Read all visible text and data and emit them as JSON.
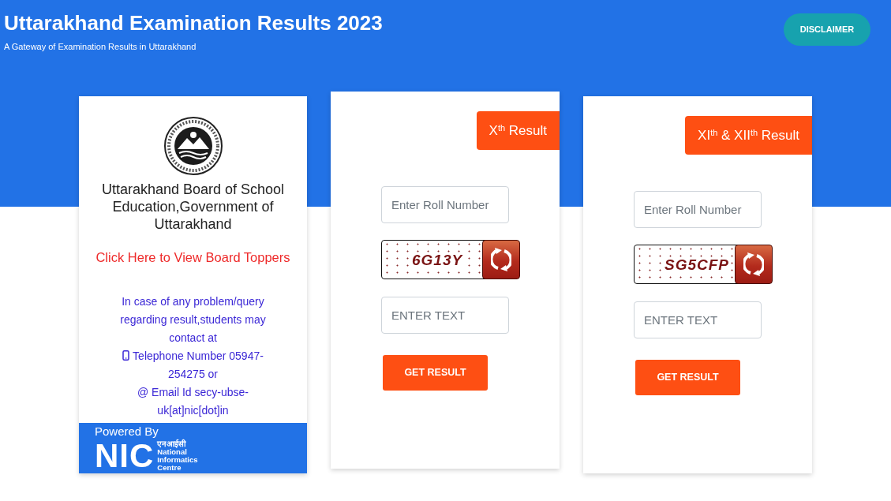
{
  "header": {
    "title": "Uttarakhand Examination Results 2023",
    "subtitle": "A Gateway of Examination Results in Uttarakhand",
    "disclaimer_button": "DISCLAIMER"
  },
  "board_card": {
    "name": "Uttarakhand Board of School Education,Government of Uttarakhand",
    "toppers_link": "Click Here to View Board Toppers",
    "contact_intro": "In case of any problem/query regarding result,students may contact at",
    "telephone": "Telephone Number 05947-254275 or",
    "email": "@ Email Id secy-ubse-uk[at]nic[dot]in",
    "footer": {
      "powered_by": "Powered By",
      "logo_mark": "NIC",
      "logo_hindi": "एनआईसी",
      "logo_lines": [
        "National",
        "Informatics",
        "Centre"
      ]
    }
  },
  "result_cards": [
    {
      "heading": "X$^{th}$ Result",
      "roll_field": {
        "placeholder": "Enter Roll Number"
      },
      "captcha": "6G13Y",
      "text_field": {
        "placeholder": "ENTER TEXT"
      },
      "button": "GET RESULT"
    },
    {
      "heading": "XI$^{th}$ & XII$^{th}$ Result",
      "roll_field": {
        "placeholder": "Enter Roll Number"
      },
      "captcha": "SG5CFP",
      "text_field": {
        "placeholder": "ENTER TEXT"
      },
      "button": "GET RESULT"
    }
  ]
}
